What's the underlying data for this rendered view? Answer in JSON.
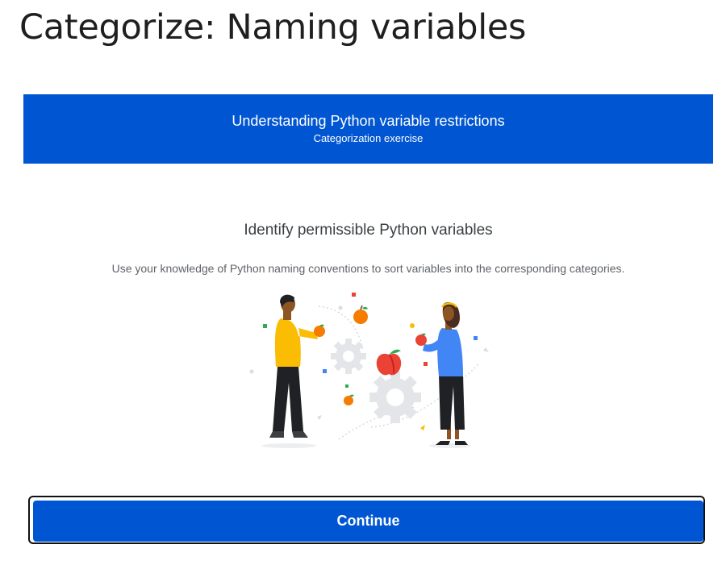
{
  "page": {
    "title": "Categorize: Naming variables"
  },
  "banner": {
    "title": "Understanding Python variable restrictions",
    "subtitle": "Categorization exercise",
    "color": "#0056d2"
  },
  "content": {
    "heading": "Identify permissible Python variables",
    "description": "Use your knowledge of Python naming conventions to sort variables into the corresponding categories.",
    "illustration_icon": "people-sharing-apples-illustration"
  },
  "actions": {
    "continue_label": "Continue",
    "accent_color": "#0056d2"
  }
}
